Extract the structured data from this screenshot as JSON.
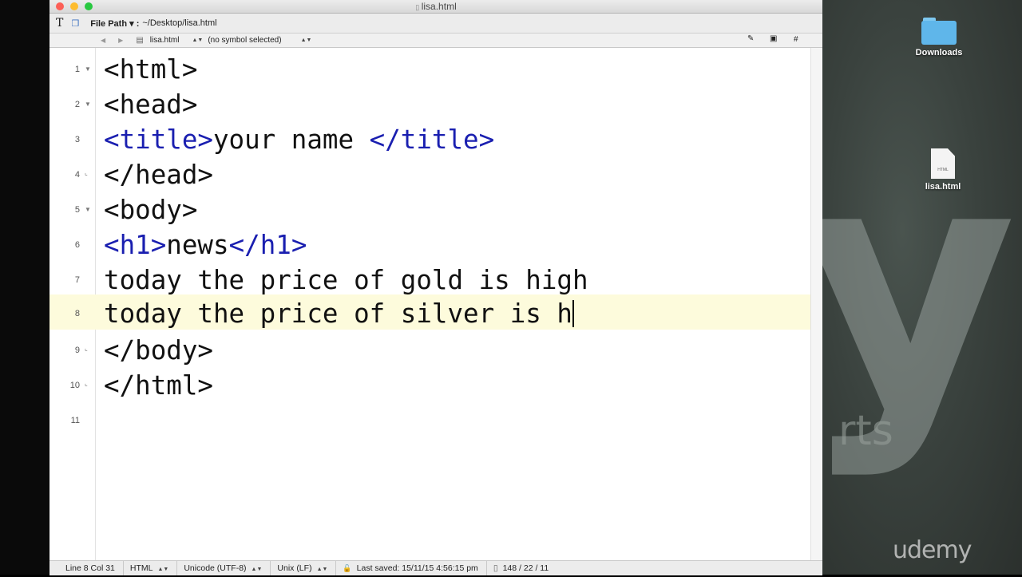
{
  "window": {
    "title": "lisa.html"
  },
  "toolbar": {
    "text_tool": "T",
    "file_path_label": "File Path ▾ :",
    "file_path_value": "~/Desktop/lisa.html"
  },
  "navbar": {
    "file_name": "lisa.html",
    "symbol": "(no symbol selected)",
    "hash": "#"
  },
  "editor": {
    "current_line": 8,
    "lines": [
      {
        "num": "1",
        "fold": "▼"
      },
      {
        "num": "2",
        "fold": "▼"
      },
      {
        "num": "3",
        "fold": ""
      },
      {
        "num": "4",
        "fold": "⌞"
      },
      {
        "num": "5",
        "fold": "▼"
      },
      {
        "num": "6",
        "fold": ""
      },
      {
        "num": "7",
        "fold": ""
      },
      {
        "num": "8",
        "fold": ""
      },
      {
        "num": "9",
        "fold": "⌞"
      },
      {
        "num": "10",
        "fold": "⌞"
      },
      {
        "num": "11",
        "fold": ""
      }
    ],
    "code": {
      "l1": "<html>",
      "l2": "<head>",
      "l3_open": "<title>",
      "l3_text": "your name ",
      "l3_close": "</title>",
      "l4": "</head>",
      "l5": "<body>",
      "l6_open": "<h1>",
      "l6_text": "news",
      "l6_close": "</h1>",
      "l7": "today the price of gold is high",
      "l8": "today the price of silver is h",
      "l9": "</body>",
      "l10": "</html>"
    }
  },
  "status": {
    "position": "Line 8 Col 31",
    "language": "HTML",
    "encoding": "Unicode (UTF-8)",
    "line_endings": "Unix (LF)",
    "last_saved": "Last saved: 15/11/15 4:56:15 pm",
    "counts": "148 / 22 / 11"
  },
  "desktop": {
    "items": [
      {
        "label": "Downloads",
        "icon": "folder-icon"
      },
      {
        "label": "lisa.html",
        "icon": "html-file-icon",
        "badge": "HTML"
      }
    ],
    "watermark": "udemy",
    "background_text": "rts"
  },
  "colors": {
    "tag": "#1a1fb0",
    "text": "#111111",
    "current_line": "#fdfbdc"
  }
}
